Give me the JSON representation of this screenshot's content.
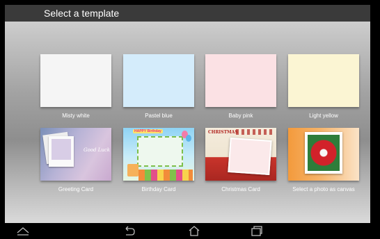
{
  "header": {
    "title": "Select a template"
  },
  "templates": [
    {
      "label": "Misty white",
      "color": "#f5f5f5"
    },
    {
      "label": "Pastel blue",
      "color": "#d4ecfb"
    },
    {
      "label": "Baby pink",
      "color": "#fbe1e4"
    },
    {
      "label": "Light yellow",
      "color": "#fbf5d3"
    },
    {
      "label": "Greeting Card",
      "card_text": "Good Luck"
    },
    {
      "label": "Birthday Card",
      "card_text": "HAPPY Birthday"
    },
    {
      "label": "Christmas Card",
      "card_text": "CHRISTMAS"
    },
    {
      "label": "Select a photo as canvas"
    }
  ],
  "navbar": {
    "icons": [
      "recent-up-icon",
      "back-icon",
      "home-icon",
      "recent-apps-icon"
    ]
  }
}
